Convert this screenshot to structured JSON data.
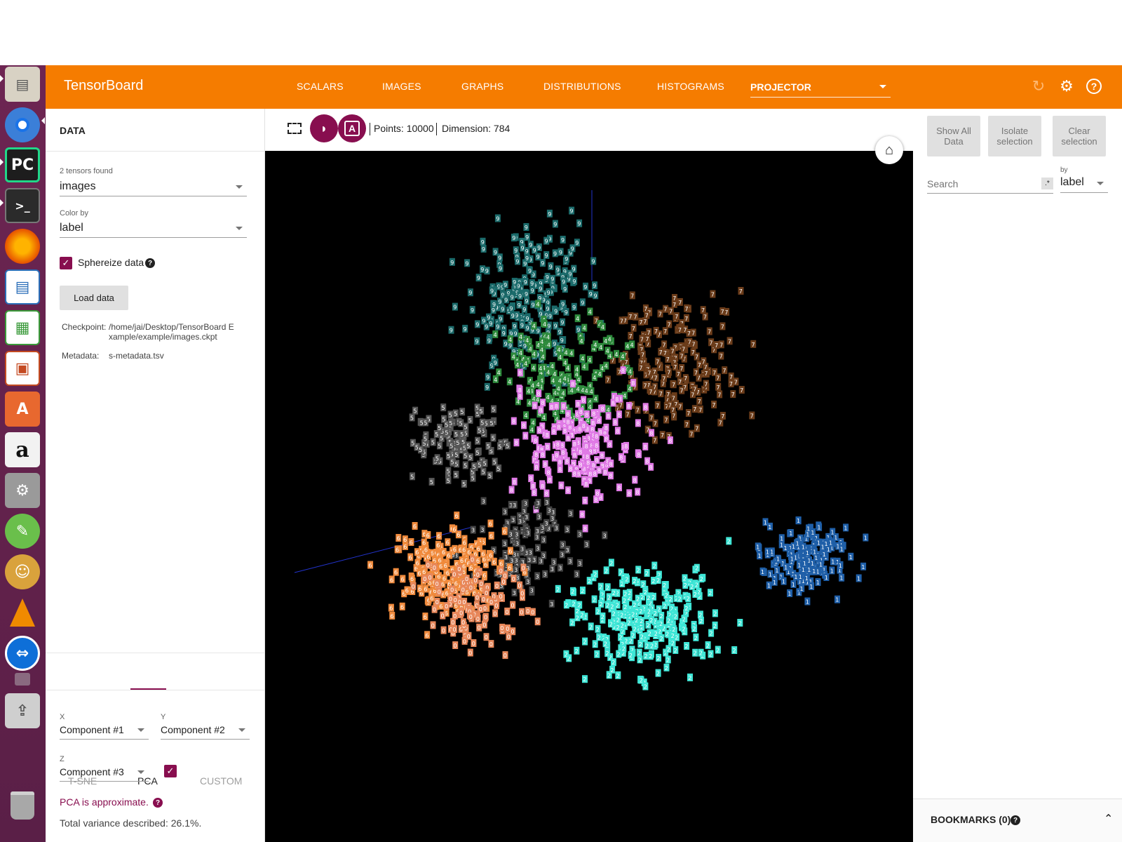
{
  "launcher": {
    "icons": [
      "file-cabinet-icon",
      "chrome-icon",
      "pycharm-icon",
      "terminal-icon",
      "firefox-icon",
      "writer-icon",
      "calc-icon",
      "impress-icon",
      "software-center-icon",
      "amazon-icon",
      "system-settings-icon",
      "leafpad-icon",
      "cat-app-icon",
      "vlc-icon",
      "teamviewer-icon",
      "camera-icon",
      "usb-drive-icon",
      "trash-icon"
    ],
    "pycharm_label": "PC"
  },
  "header": {
    "title": "TensorBoard",
    "tabs": [
      "SCALARS",
      "IMAGES",
      "GRAPHS",
      "DISTRIBUTIONS",
      "HISTOGRAMS"
    ],
    "active_select": "PROJECTOR"
  },
  "left": {
    "title": "DATA",
    "tensors_label": "2 tensors found",
    "tensor_value": "images",
    "color_by_label": "Color by",
    "color_by_value": "label",
    "spherize_label": "Sphereize data",
    "load_button": "Load data",
    "checkpoint_key": "Checkpoint:",
    "checkpoint_line1": "/home/jai/Desktop/TensorBoard E",
    "checkpoint_line2": "xample/example/images.ckpt",
    "metadata_key": "Metadata:",
    "metadata_value": "s-metadata.tsv",
    "proj_tabs": [
      "T-SNE",
      "PCA",
      "CUSTOM"
    ],
    "x_label": "X",
    "x_value": "Component #1",
    "y_label": "Y",
    "y_value": "Component #2",
    "z_label": "Z",
    "z_value": "Component #3",
    "pca_note": "PCA is approximate.",
    "variance": "Total variance described: 26.1%."
  },
  "toolbar": {
    "night_mode_glyph": "◗",
    "label_mode_glyph": "A",
    "points": "Points: 10000",
    "dimension": "Dimension: 784"
  },
  "right": {
    "show_all": "Show All Data",
    "isolate": "Isolate selection",
    "clear": "Clear selection",
    "search_placeholder": "Search",
    "regex_glyph": ".*",
    "by_label": "by",
    "by_value": "label",
    "bookmarks": "BOOKMARKS (0)"
  },
  "colors": {
    "header": "#f57c00",
    "accent": "#880e4f",
    "launcher": "#5f2049",
    "digit_0": "#e8875a",
    "digit_1": "#1f5fa8",
    "digit_2": "#3ee6d6",
    "digit_3": "#444444",
    "digit_4": "#2e8b3d",
    "digit_5": "#555555",
    "digit_6": "#f08a3c",
    "digit_7": "#6b3c1a",
    "digit_8": "#e07ae6",
    "digit_9": "#1b6b6b"
  }
}
